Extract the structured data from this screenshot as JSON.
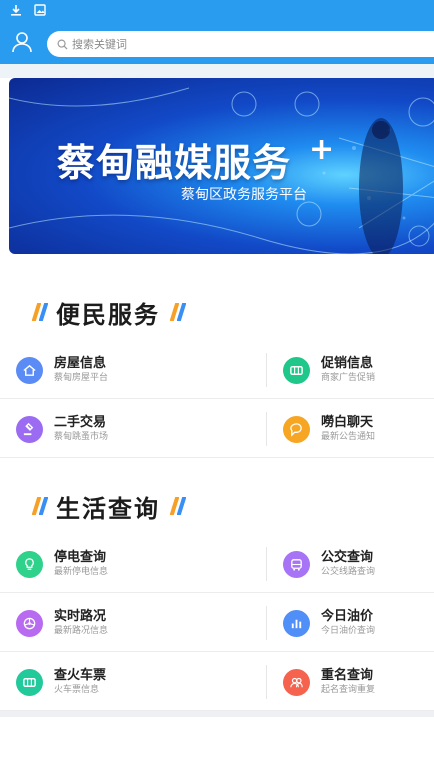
{
  "statusbar": {
    "icons": [
      "download-icon",
      "image-icon"
    ]
  },
  "search": {
    "placeholder": "搜索关键词"
  },
  "banner": {
    "title": "蔡甸融媒服务",
    "plus": "+",
    "subtitle": "蔡甸区政务服务平台"
  },
  "sections": [
    {
      "title": "便民服务",
      "rows": [
        [
          {
            "title": "房屋信息",
            "subtitle": "蔡甸房屋平台",
            "icon": "house-icon",
            "color": "#5b8cf5"
          },
          {
            "title": "促销信息",
            "subtitle": "商家广告促销",
            "icon": "ticket-icon",
            "color": "#20c78a"
          }
        ],
        [
          {
            "title": "二手交易",
            "subtitle": "蔡甸跳蚤市场",
            "icon": "gavel-icon",
            "color": "#9b6cf2"
          },
          {
            "title": "嘮白聊天",
            "subtitle": "最新公告通知",
            "icon": "chat-icon",
            "color": "#f6a623"
          }
        ]
      ]
    },
    {
      "title": "生活查询",
      "rows": [
        [
          {
            "title": "停电查询",
            "subtitle": "最新停电信息",
            "icon": "bulb-icon",
            "color": "#2ed28a"
          },
          {
            "title": "公交查询",
            "subtitle": "公交线路查询",
            "icon": "bus-icon",
            "color": "#a774f5"
          }
        ],
        [
          {
            "title": "实时路况",
            "subtitle": "最新路况信息",
            "icon": "wheel-icon",
            "color": "#b86af0"
          },
          {
            "title": "今日油价",
            "subtitle": "今日油价查询",
            "icon": "chart-icon",
            "color": "#4f8ff7"
          }
        ],
        [
          {
            "title": "查火车票",
            "subtitle": "火车票信息",
            "icon": "ticket-icon",
            "color": "#22c99b"
          },
          {
            "title": "重名查询",
            "subtitle": "起名查询重复",
            "icon": "people-icon",
            "color": "#f5634f"
          }
        ]
      ]
    }
  ],
  "colors": {
    "brand_blue": "#2a9cf0",
    "slash_orange": "#f7a028",
    "slash_blue": "#3a8ff5"
  }
}
